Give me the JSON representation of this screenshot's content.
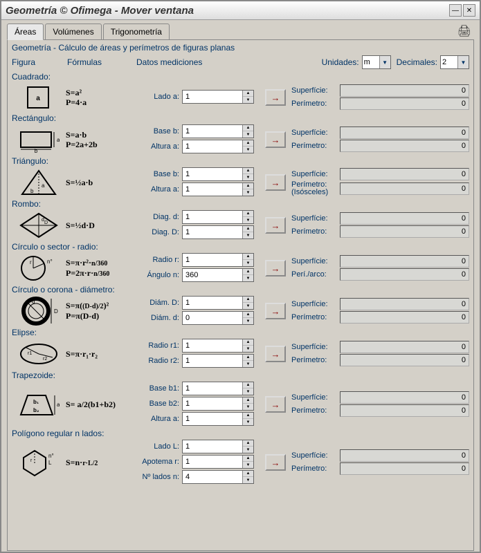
{
  "titlebar": "Geometría  © Ofimega - Mover ventana",
  "tabs": {
    "areas": "Áreas",
    "volumenes": "Volúmenes",
    "trig": "Trigonometría"
  },
  "pane_title": "Geometría - Cálculo de áreas y perímetros de figuras planas",
  "columns": {
    "figura": "Figura",
    "formulas": "Fórmulas",
    "datos": "Datos mediciones"
  },
  "unidades_label": "Unidades:",
  "unidades_value": "m",
  "decimales_label": "Decimales:",
  "decimales_value": "2",
  "shapes": [
    {
      "title": "Cuadrado:",
      "formula_html": "S=a²<br>P=4·a",
      "inputs": [
        {
          "label": "Lado a:",
          "val": "1"
        }
      ],
      "results": [
        {
          "label": "Superfície:",
          "val": "0"
        },
        {
          "label": "Perímetro:",
          "val": "0"
        }
      ]
    },
    {
      "title": "Rectángulo:",
      "formula_html": "S=a·b<br>P=2a+2b",
      "inputs": [
        {
          "label": "Base b:",
          "val": "1"
        },
        {
          "label": "Altura a:",
          "val": "1"
        }
      ],
      "results": [
        {
          "label": "Superfície:",
          "val": "0"
        },
        {
          "label": "Perímetro:",
          "val": "0"
        }
      ]
    },
    {
      "title": "Triángulo:",
      "formula_html": "S=½a·b",
      "inputs": [
        {
          "label": "Base b:",
          "val": "1"
        },
        {
          "label": "Altura a:",
          "val": "1"
        }
      ],
      "results": [
        {
          "label": "Superfície:",
          "val": "0"
        },
        {
          "label": "Perímetro:<br>(Isósceles)",
          "val": "0"
        }
      ]
    },
    {
      "title": "Rombo:",
      "formula_html": "S=½d·D",
      "inputs": [
        {
          "label": "Diag. d:",
          "val": "1"
        },
        {
          "label": "Diag. D:",
          "val": "1"
        }
      ],
      "results": [
        {
          "label": "Superfície:",
          "val": "0"
        },
        {
          "label": "Perímetro:",
          "val": "0"
        }
      ]
    },
    {
      "title": "Círculo o sector - radio:",
      "formula_html": "S=π·r²·<small>n/360</small><br>P=2π·r·<small>n/360</small>",
      "inputs": [
        {
          "label": "Radio r:",
          "val": "1"
        },
        {
          "label": "Ángulo n:",
          "val": "360"
        }
      ],
      "results": [
        {
          "label": "Superfície:",
          "val": "0"
        },
        {
          "label": "Perí./arco:",
          "val": "0"
        }
      ]
    },
    {
      "title": "Círculo o corona - diámetro:",
      "formula_html": "S=π(<small>(D-d)/2</small>)²<br>P=π(D-d)",
      "inputs": [
        {
          "label": "Diám. D:",
          "val": "1"
        },
        {
          "label": "Diám. d:",
          "val": "0"
        }
      ],
      "results": [
        {
          "label": "Superfície:",
          "val": "0"
        },
        {
          "label": "Perímetro:",
          "val": "0"
        }
      ]
    },
    {
      "title": "Elipse:",
      "formula_html": "S=π·r₁·r₂",
      "inputs": [
        {
          "label": "Radio r1:",
          "val": "1"
        },
        {
          "label": "Radio r2:",
          "val": "1"
        }
      ],
      "results": [
        {
          "label": "Superfície:",
          "val": "0"
        },
        {
          "label": "Perímetro:",
          "val": "0"
        }
      ]
    },
    {
      "title": "Trapezoide:",
      "formula_html": "S=&nbsp;a/2(b1+b2)",
      "inputs": [
        {
          "label": "Base b1:",
          "val": "1"
        },
        {
          "label": "Base b2:",
          "val": "1"
        },
        {
          "label": "Altura a:",
          "val": "1"
        }
      ],
      "results": [
        {
          "label": "Superfície:",
          "val": "0"
        },
        {
          "label": "Perímetro:",
          "val": "0"
        }
      ]
    },
    {
      "title": "Polígono regular n lados:",
      "formula_html": "S=n·<small>r·L/2</small>",
      "inputs": [
        {
          "label": "Lado L:",
          "val": "1"
        },
        {
          "label": "Apotema r:",
          "val": "1"
        },
        {
          "label": "Nº lados n:",
          "val": "4"
        }
      ],
      "results": [
        {
          "label": "Superfície:",
          "val": "0"
        },
        {
          "label": "Perímetro:",
          "val": "0"
        }
      ]
    }
  ],
  "arrow": "→"
}
